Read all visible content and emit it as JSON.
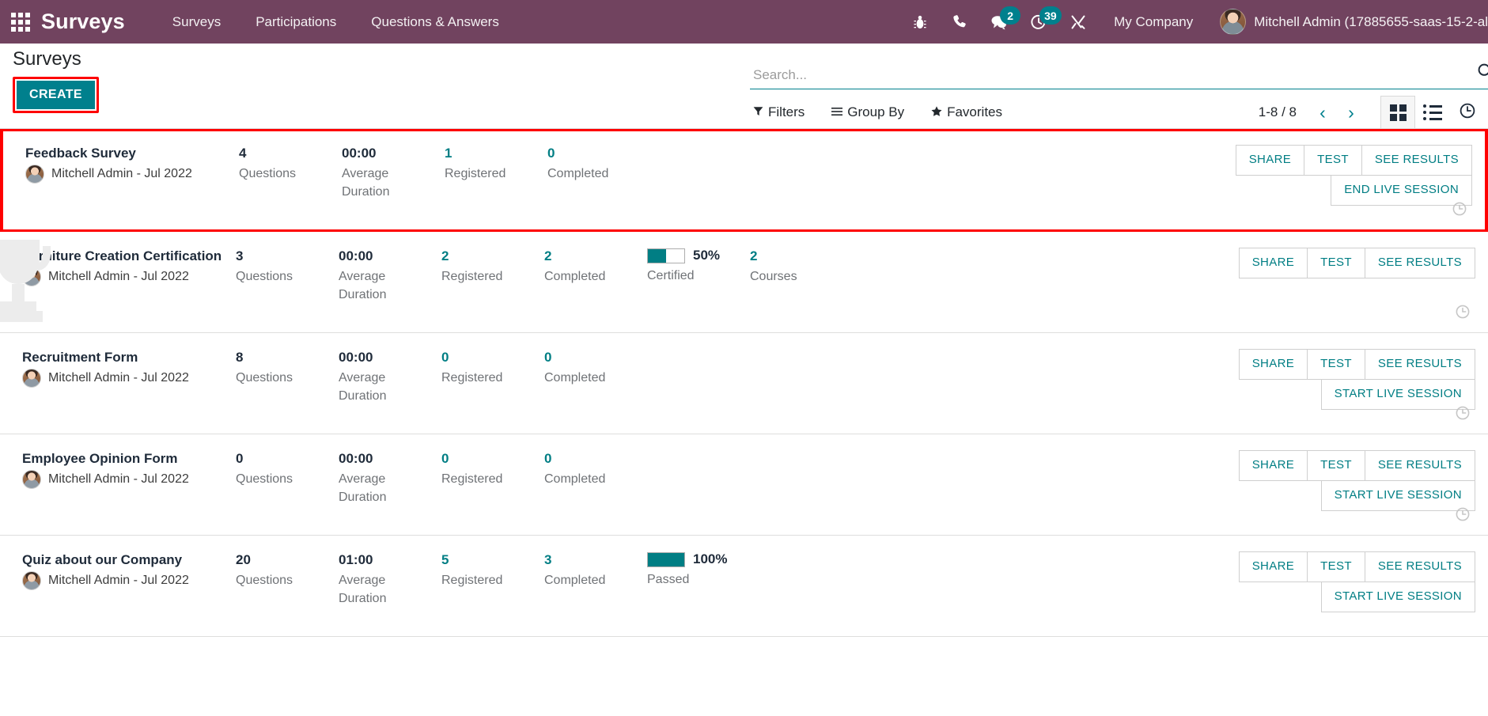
{
  "navbar": {
    "apps_icon": "apps-grid-icon",
    "brand": "Surveys",
    "menu": [
      {
        "label": "Surveys"
      },
      {
        "label": "Participations"
      },
      {
        "label": "Questions & Answers"
      }
    ],
    "sys_icons": [
      {
        "name": "bug-icon",
        "badge": ""
      },
      {
        "name": "phone-icon",
        "badge": ""
      },
      {
        "name": "chat-icon",
        "badge": "2"
      },
      {
        "name": "activity-clock-icon",
        "badge": "39"
      },
      {
        "name": "tools-icon",
        "badge": ""
      }
    ],
    "company": "My Company",
    "user": "Mitchell Admin (17885655-saas-15-2-al",
    "accent_teal": "#00808d",
    "navbar_purple": "#71435f"
  },
  "control_panel": {
    "title": "Surveys",
    "create_label": "CREATE",
    "highlight_color": "#fe0000",
    "search": {
      "placeholder": "Search...",
      "value": "",
      "icon": "search-icon"
    },
    "filters": [
      {
        "label": "Filters",
        "icon": "filter-funnel-icon"
      },
      {
        "label": "Group By",
        "icon": "group-lines-icon"
      },
      {
        "label": "Favorites",
        "icon": "star-icon"
      }
    ],
    "pager": {
      "count": "1-8 / 8",
      "prev": "‹",
      "next": "›"
    },
    "views": [
      {
        "name": "kanban-view",
        "active": true
      },
      {
        "name": "list-view",
        "active": false
      },
      {
        "name": "activity-view",
        "active": false
      }
    ]
  },
  "labels": {
    "questions": "Questions",
    "average_duration": "Average Duration",
    "registered": "Registered",
    "completed": "Completed",
    "certified": "Certified",
    "courses": "Courses",
    "passed": "Passed",
    "share": "SHARE",
    "test": "TEST",
    "see_results": "SEE RESULTS",
    "end_live_session": "END LIVE SESSION",
    "start_live_session": "START LIVE SESSION"
  },
  "records": [
    {
      "name": "Feedback Survey",
      "author": "Mitchell Admin - Jul 2022",
      "questions": "4",
      "duration": "00:00",
      "registered": "1",
      "completed": "0",
      "certified_pct": null,
      "certified_label": null,
      "courses": null,
      "live_session_label": "END LIVE SESSION",
      "highlighted": true,
      "trophy": false
    },
    {
      "name": "Furniture Creation Certification",
      "author": "Mitchell Admin - Jul 2022",
      "questions": "3",
      "duration": "00:00",
      "registered": "2",
      "completed": "2",
      "certified_pct": "50%",
      "certified_label": "Certified",
      "certified_value": 50,
      "courses": "2",
      "courses_label": "Courses",
      "live_session_label": null,
      "highlighted": false,
      "trophy": true
    },
    {
      "name": "Recruitment Form",
      "author": "Mitchell Admin - Jul 2022",
      "questions": "8",
      "duration": "00:00",
      "registered": "0",
      "completed": "0",
      "certified_pct": null,
      "certified_label": null,
      "courses": null,
      "live_session_label": "START LIVE SESSION",
      "highlighted": false,
      "trophy": false
    },
    {
      "name": "Employee Opinion Form",
      "author": "Mitchell Admin - Jul 2022",
      "questions": "0",
      "duration": "00:00",
      "registered": "0",
      "completed": "0",
      "certified_pct": null,
      "certified_label": null,
      "courses": null,
      "live_session_label": "START LIVE SESSION",
      "highlighted": false,
      "trophy": false
    },
    {
      "name": "Quiz about our Company",
      "author": "Mitchell Admin - Jul 2022",
      "questions": "20",
      "duration": "01:00",
      "registered": "5",
      "completed": "3",
      "certified_pct": "100%",
      "certified_label": "Passed",
      "certified_value": 100,
      "courses": null,
      "live_session_label": "START LIVE SESSION",
      "highlighted": false,
      "trophy": false
    }
  ]
}
